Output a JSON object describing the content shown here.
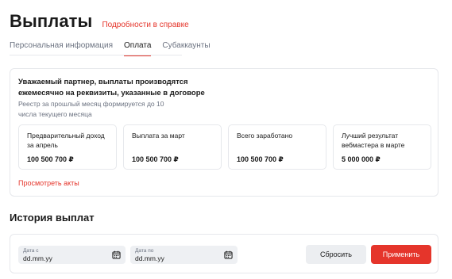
{
  "header": {
    "title": "Выплаты",
    "help_link": "Подробности в справке"
  },
  "tabs": [
    {
      "label": "Персональная информация",
      "active": false
    },
    {
      "label": "Оплата",
      "active": true
    },
    {
      "label": "Субаккаунты",
      "active": false
    }
  ],
  "info": {
    "notice": "Уважаемый партнер, выплаты производятся ежемесячно на реквизиты, указанные в договоре",
    "note": "Реестр за прошлый месяц формируется до 10 числа текущего месяца",
    "stats": [
      {
        "label": "Предварительный доход за апрель",
        "value": "100 500 700 ₽"
      },
      {
        "label": "Выплата за март",
        "value": "100 500 700 ₽"
      },
      {
        "label": "Всего заработано",
        "value": "100 500 700 ₽"
      },
      {
        "label": "Лучший результат вебмастера в марте",
        "value": "5 000 000 ₽"
      }
    ],
    "acts_link": "Просмотреть акты"
  },
  "history": {
    "title": "История выплат",
    "date_from": {
      "label": "Дата с",
      "value": "dd.mm.yy"
    },
    "date_to": {
      "label": "Дата по",
      "value": "dd.mm.yy"
    },
    "reset_label": "Сбросить",
    "apply_label": "Применить"
  },
  "colors": {
    "accent": "#e5352b",
    "border": "#e6e8ec",
    "muted_text": "#6b7280"
  }
}
